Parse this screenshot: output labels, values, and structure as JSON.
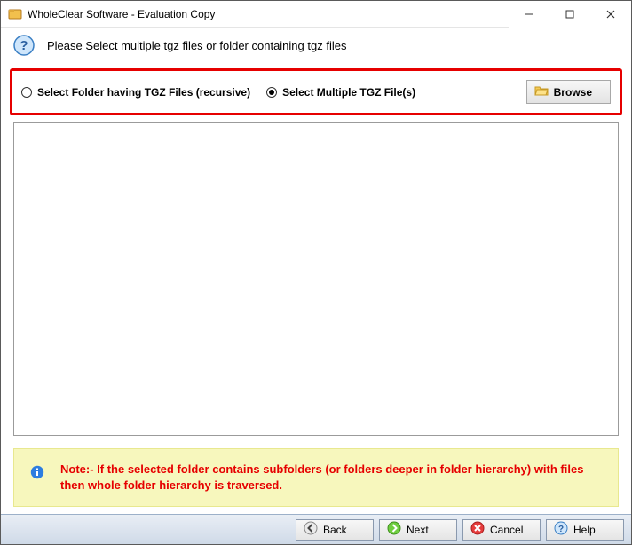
{
  "window": {
    "title": "WholeClear Software - Evaluation Copy"
  },
  "instruction": "Please Select multiple tgz files or folder containing tgz files",
  "options": {
    "folder": {
      "label": "Select Folder having TGZ Files (recursive)",
      "selected": false
    },
    "files": {
      "label": "Select Multiple TGZ File(s)",
      "selected": true
    },
    "browse": "Browse"
  },
  "note": "Note:- If the selected folder contains subfolders (or folders deeper in folder hierarchy) with files then whole folder hierarchy is traversed.",
  "buttons": {
    "back": "Back",
    "next": "Next",
    "cancel": "Cancel",
    "help": "Help"
  }
}
